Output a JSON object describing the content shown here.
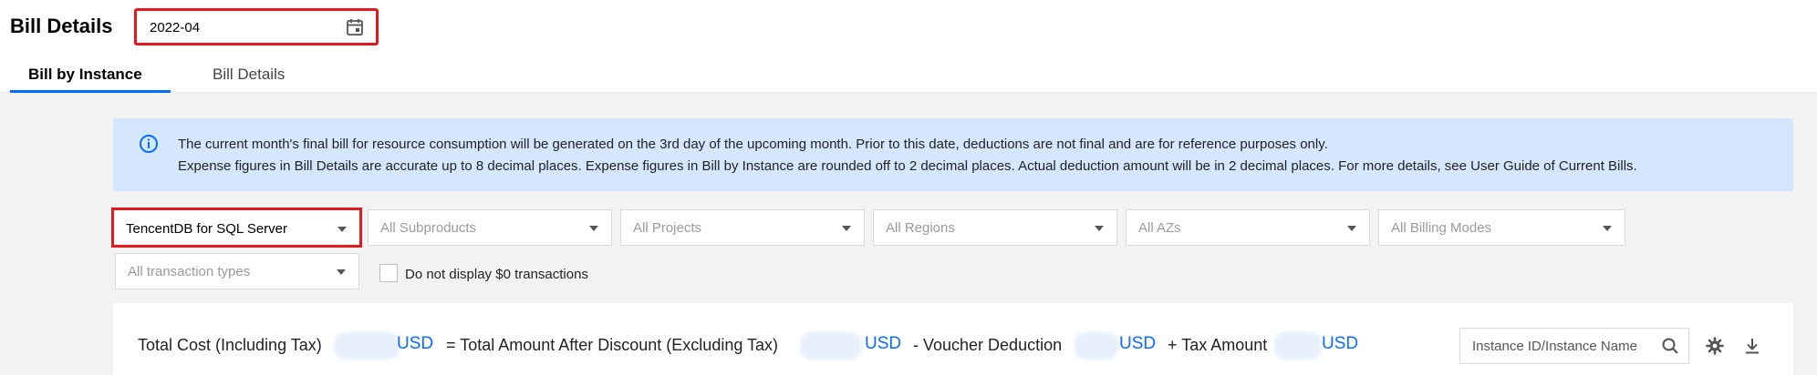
{
  "header": {
    "title": "Bill Details",
    "month_value": "2022-04"
  },
  "tabs": [
    {
      "label": "Bill by Instance",
      "active": true
    },
    {
      "label": "Bill Details",
      "active": false
    }
  ],
  "notice": {
    "line1": "The current month's final bill for resource consumption will be generated on the 3rd day of the upcoming month. Prior to this date, deductions are not final and are for reference purposes only.",
    "line2": "Expense figures in Bill Details are accurate up to 8 decimal places. Expense figures in Bill by Instance are rounded off to 2 decimal places. Actual deduction amount will be in 2 decimal places. For more details, see User Guide of Current Bills."
  },
  "filters": {
    "product": "TencentDB for SQL Server",
    "subproduct": "All Subproducts",
    "project": "All Projects",
    "region": "All Regions",
    "az": "All AZs",
    "billing_mode": "All Billing Modes",
    "transaction_type": "All transaction types",
    "hide_zero_label": "Do not display $0 transactions",
    "hide_zero_checked": false
  },
  "summary": {
    "total_cost_label": "Total Cost (Including Tax)",
    "currency": "USD",
    "after_discount_label": "= Total Amount After Discount (Excluding Tax)",
    "voucher_label": "- Voucher Deduction",
    "tax_label": "+ Tax Amount"
  },
  "search": {
    "placeholder": "Instance ID/Instance Name"
  },
  "colors": {
    "accent": "#006eff",
    "highlight": "#e3191e",
    "notice_bg": "#d5e7ff",
    "amount_blue": "#0a6cff"
  }
}
